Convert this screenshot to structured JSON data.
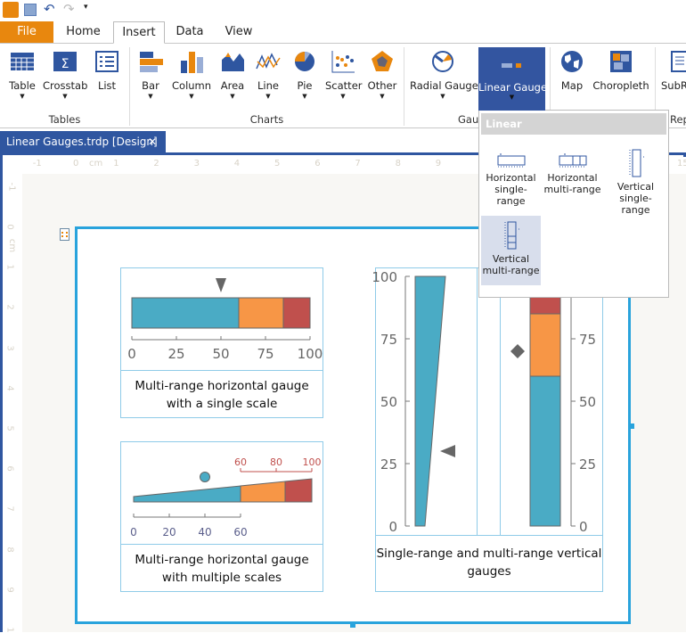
{
  "quick_access": {
    "icons": [
      "app-logo-icon",
      "save-icon",
      "undo-icon",
      "redo-icon",
      "customize-icon"
    ]
  },
  "menu_tabs": {
    "file": "File",
    "home": "Home",
    "insert": "Insert",
    "data": "Data",
    "view": "View",
    "active": "Insert"
  },
  "ribbon": {
    "tables": {
      "label": "Tables",
      "items": [
        "Table",
        "Crosstab",
        "List"
      ]
    },
    "charts": {
      "label": "Charts",
      "items": [
        "Bar",
        "Column",
        "Area",
        "Line",
        "Pie",
        "Scatter",
        "Other"
      ]
    },
    "gauges": {
      "label": "Gau",
      "items": [
        "Radial Gauge",
        "Linear Gauge"
      ]
    },
    "maps": {
      "items": [
        "Map",
        "Choropleth"
      ]
    },
    "report": {
      "label": "Rep",
      "items": [
        "SubR"
      ]
    }
  },
  "document_tab": {
    "title": "Linear Gauges.trdp [Design]",
    "close": "✕"
  },
  "ruler": {
    "unit": "cm",
    "h_ticks": [
      "-1",
      "0",
      "1",
      "2",
      "3",
      "4",
      "5",
      "6",
      "7",
      "8",
      "9",
      "15"
    ],
    "v_ticks": [
      "-1",
      "0",
      "1",
      "2",
      "3",
      "4",
      "5",
      "6",
      "7",
      "8",
      "9",
      "1"
    ]
  },
  "dropdown": {
    "header": "Linear",
    "items": [
      {
        "label": "Horizontal single-range"
      },
      {
        "label": "Horizontal multi-range"
      },
      {
        "label": "Vertical single-range"
      },
      {
        "label": "Vertical multi-range",
        "selected": true
      }
    ]
  },
  "colors": {
    "range1": "#4aabc5",
    "range2": "#f79646",
    "range3": "#c0504d",
    "pointer": "#666666",
    "accent": "#2f56a0",
    "file": "#e8870e",
    "report_border": "#29a3dc"
  },
  "gauges": [
    {
      "caption": "Multi-range horizontal gauge with a single scale",
      "ranges": [
        [
          0,
          60
        ],
        [
          60,
          85
        ],
        [
          85,
          100
        ]
      ],
      "pointer": {
        "shape": "triangle",
        "value": 50
      },
      "scale": {
        "min": 0,
        "max": 100,
        "ticks": [
          "0",
          "25",
          "50",
          "75",
          "100"
        ]
      }
    },
    {
      "caption": "Multi-range horizontal gauge with multiple scales",
      "ranges": [
        [
          0,
          60
        ],
        [
          60,
          85
        ],
        [
          85,
          100
        ]
      ],
      "pointer": {
        "shape": "circle",
        "value": 40
      },
      "scales": [
        {
          "min": 0,
          "max": 60,
          "ticks": [
            "0",
            "20",
            "40",
            "60"
          ]
        },
        {
          "min": 60,
          "max": 100,
          "ticks": [
            "60",
            "80",
            "100"
          ]
        }
      ]
    },
    {
      "caption": "Single-range and multi-range vertical gauges",
      "single": {
        "range": [
          0,
          100
        ],
        "pointer": {
          "shape": "triangle",
          "value": 30
        },
        "scale": {
          "ticks": [
            "0",
            "25",
            "50",
            "75",
            "100"
          ]
        }
      },
      "multi": {
        "ranges": [
          [
            0,
            60
          ],
          [
            60,
            85
          ],
          [
            85,
            100
          ]
        ],
        "pointer": {
          "shape": "diamond",
          "value": 70
        },
        "scale": {
          "ticks": [
            "0",
            "25",
            "50",
            "75"
          ]
        }
      }
    }
  ]
}
